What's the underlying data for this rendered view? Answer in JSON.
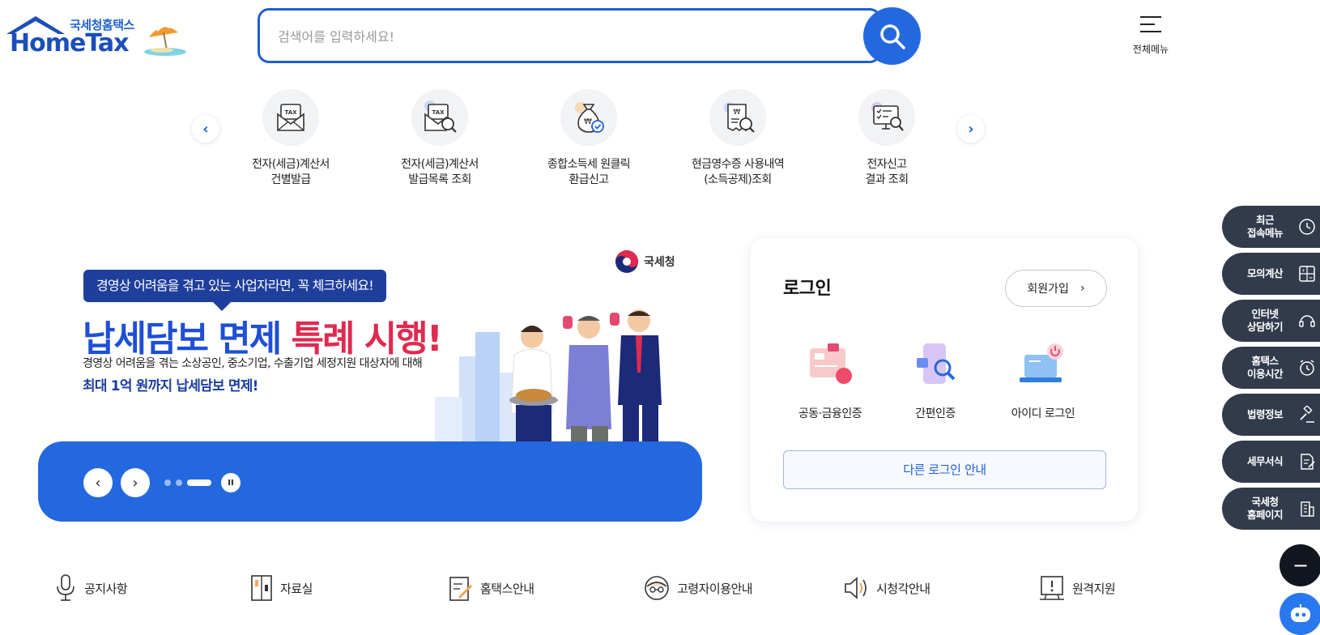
{
  "header": {
    "logo_sub": "국세청홈택스",
    "logo_main": "HomeTax",
    "search_placeholder": "검색어를 입력하세요!",
    "all_menu_label": "전체메뉴"
  },
  "quick_menu": {
    "items": [
      {
        "label": "전자(세금)계산서\n건별발급",
        "icon": "tax-envelope-icon"
      },
      {
        "label": "전자(세금)계산서\n발급목록 조회",
        "icon": "tax-search-icon"
      },
      {
        "label": "종합소득세 원클릭\n환급신고",
        "icon": "refund-bag-icon"
      },
      {
        "label": "현금영수증 사용내역\n(소득공제)조회",
        "icon": "receipt-search-icon"
      },
      {
        "label": "전자신고\n결과 조회",
        "icon": "monitor-check-icon"
      }
    ]
  },
  "banner": {
    "pill_text": "경영상 어려움을 겪고 있는 사업자라면, 꼭 체크하세요!",
    "headline_blue": "납세담보 면제",
    "headline_red": "특례 시행!",
    "desc1": "경영상 어려움을 겪는 소상공인, 중소기업, 수출기업 세정지원 대상자에 대해",
    "desc2": "최대 1억 원까지 납세담보 면제!",
    "agency": "국세청",
    "slide_count": 3,
    "active_slide": 3
  },
  "login": {
    "title": "로그인",
    "join_label": "회원가입",
    "options": [
      {
        "label": "공동·금융인증",
        "icon": "certificate-card-icon"
      },
      {
        "label": "간편인증",
        "icon": "simple-auth-icon"
      },
      {
        "label": "아이디 로그인",
        "icon": "laptop-power-icon"
      }
    ],
    "other_label": "다른 로그인 안내"
  },
  "side_menu": [
    {
      "label": "최근\n접속메뉴",
      "icon": "clock-icon"
    },
    {
      "label": "모의계산",
      "icon": "calculator-icon"
    },
    {
      "label": "인터넷\n상담하기",
      "icon": "headset-icon"
    },
    {
      "label": "홈택스\n이용시간",
      "icon": "alarm-clock-icon"
    },
    {
      "label": "법령정보",
      "icon": "gavel-icon"
    },
    {
      "label": "세무서식",
      "icon": "document-edit-icon"
    },
    {
      "label": "국세청\n홈페이지",
      "icon": "building-icon"
    }
  ],
  "bottom_menu": [
    {
      "label": "공지사항",
      "icon": "microphone-icon"
    },
    {
      "label": "자료실",
      "icon": "archive-icon"
    },
    {
      "label": "홈택스안내",
      "icon": "guide-edit-icon"
    },
    {
      "label": "고령자이용안내",
      "icon": "elderly-icon"
    },
    {
      "label": "시청각안내",
      "icon": "speaker-icon"
    },
    {
      "label": "원격지원",
      "icon": "remote-support-icon"
    }
  ],
  "colors": {
    "primary": "#2468e0",
    "navy": "#1f3f9c",
    "accent_red": "#e02a4f",
    "side_bg": "#323b4b"
  }
}
